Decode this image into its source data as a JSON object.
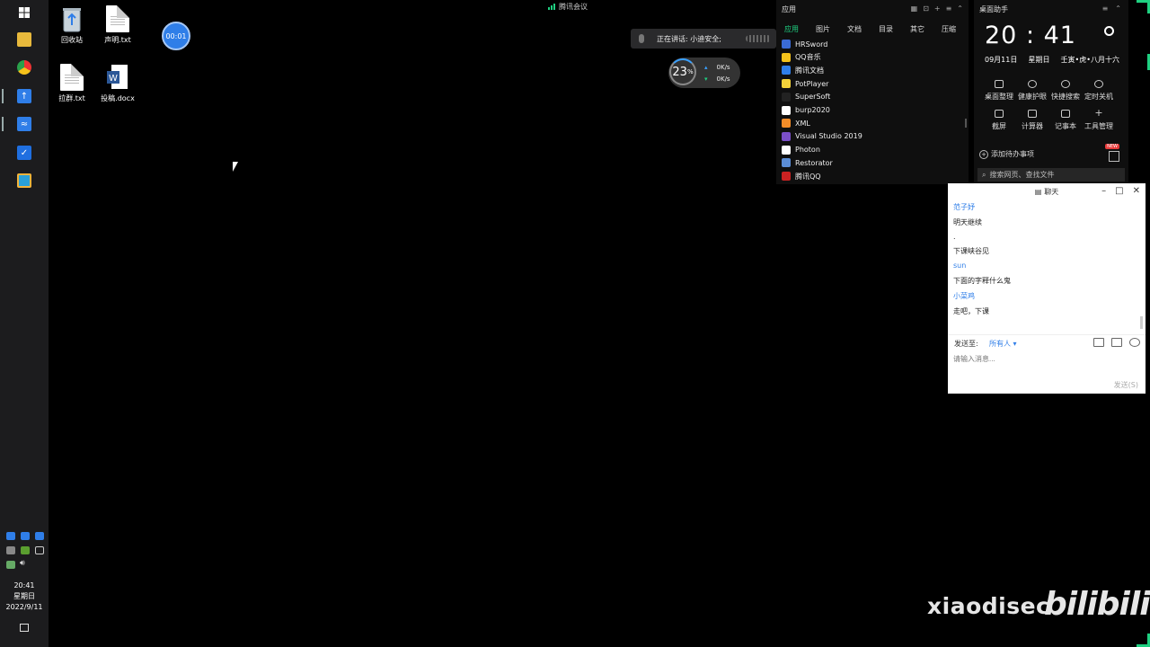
{
  "desktop": {
    "icons": [
      {
        "label": "回收站",
        "icon": "recycle-bin-icon"
      },
      {
        "label": "声明.txt",
        "icon": "txt-file-icon"
      },
      {
        "label": "拉群.txt",
        "icon": "txt-file-icon"
      },
      {
        "label": "投稿.docx",
        "icon": "word-file-icon"
      }
    ],
    "timer": "00:01"
  },
  "taskbar": {
    "time": "20:41",
    "weekday": "星期日",
    "date": "2022/9/11"
  },
  "meeting": {
    "app_label": "腾讯会议",
    "speaking_label": "正在讲话: 小迪安全;"
  },
  "speed": {
    "percent": "23",
    "unit": "%",
    "upload": "0",
    "upload_unit": "K/s",
    "download": "0",
    "download_unit": "K/s"
  },
  "apps_panel": {
    "title": "应用",
    "tabs": [
      "应用",
      "图片",
      "文档",
      "目录",
      "其它",
      "压缩"
    ],
    "items": [
      {
        "name": "HRSword",
        "color": "#3a6bd6"
      },
      {
        "name": "QQ音乐",
        "color": "#f4c21b"
      },
      {
        "name": "腾讯文档",
        "color": "#2f7ee8"
      },
      {
        "name": "PotPlayer",
        "color": "#f3d23a"
      },
      {
        "name": "SuperSoft",
        "color": "#222222"
      },
      {
        "name": "burp2020",
        "color": "#ffffff"
      },
      {
        "name": "XML",
        "color": "#f28c28"
      },
      {
        "name": "Visual Studio 2019",
        "color": "#7b4fc8"
      },
      {
        "name": "Photon",
        "color": "#ffffff"
      },
      {
        "name": "Restorator",
        "color": "#5b8dd6"
      },
      {
        "name": "腾讯QQ",
        "color": "#cc2222"
      }
    ]
  },
  "helper": {
    "title": "桌面助手",
    "clock": "20 : 41",
    "date": "09月11日",
    "weekday": "星期日",
    "lunar": "壬寅•虎•八月十六",
    "tools": [
      "桌面整理",
      "健康护眼",
      "快捷搜索",
      "定时关机",
      "截屏",
      "计算器",
      "记事本",
      "工具管理"
    ],
    "todo": "添加待办事项",
    "new_badge": "NEW",
    "search_placeholder": "搜索网页、查找文件"
  },
  "chat": {
    "title": "聊天",
    "messages": [
      {
        "name": "范子妤",
        "text": "明天继续"
      },
      {
        "name": "",
        "text": "."
      },
      {
        "name": "",
        "text": "下课峡谷见"
      },
      {
        "name": "sun",
        "text": "下面的字释什么鬼"
      },
      {
        "name": "小菜鸡",
        "text": "走吧，下课"
      }
    ],
    "send_to_label": "发送至:",
    "send_target": "所有人 ▾",
    "input_placeholder": "请输入消息...",
    "send_button": "发送(S)"
  },
  "watermark": {
    "text": "xiaodisec",
    "logo": "bilibili"
  }
}
